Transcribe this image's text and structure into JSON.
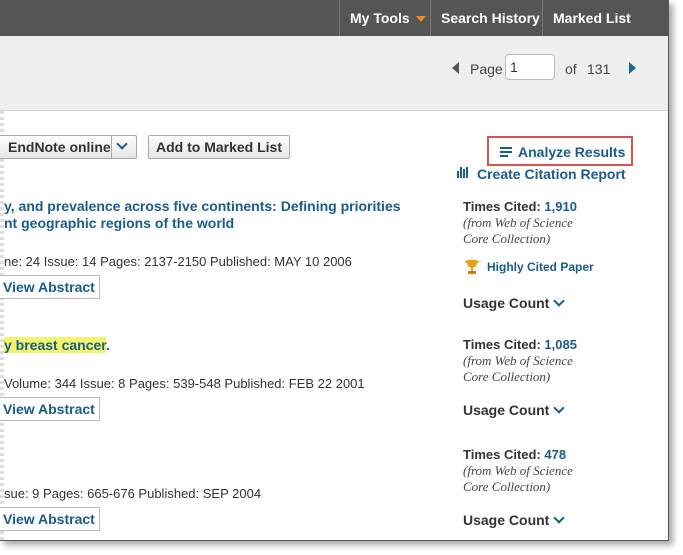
{
  "nav": {
    "my_tools": "My Tools",
    "search_history": "Search History",
    "marked_list": "Marked List"
  },
  "pager": {
    "page_label": "Page",
    "page_value": "1",
    "of_label": "of",
    "total_pages": "131"
  },
  "toolbar": {
    "endnote_label": "EndNote online",
    "add_marked": "Add to Marked List"
  },
  "side": {
    "analyze": "Analyze Results",
    "citation_report": "Create Citation Report"
  },
  "results": [
    {
      "title_line1": "y, and prevalence across five continents: Defining priorities",
      "title_line2": "nt geographic regions of the world",
      "meta": "ne: 24   Issue: 14   Pages: 2137-2150   Published: MAY 10 2006",
      "view_abstract": "View Abstract",
      "times_cited_label": "Times Cited:",
      "times_cited": "1,910",
      "source_line1": "(from Web of Science",
      "source_line2": "Core Collection)",
      "highly_cited": "Highly Cited Paper",
      "usage": "Usage Count"
    },
    {
      "title_highlight": "y breast cancer",
      "title_end": ".",
      "meta": "Volume: 344   Issue: 8   Pages: 539-548   Published: FEB 22 2001",
      "view_abstract": "View Abstract",
      "times_cited_label": "Times Cited:",
      "times_cited": "1,085",
      "source_line1": "(from Web of Science",
      "source_line2": "Core Collection)",
      "usage": "Usage Count"
    },
    {
      "meta": "sue: 9   Pages: 665-676   Published: SEP 2004",
      "view_abstract": "View Abstract",
      "times_cited_label": "Times Cited:",
      "times_cited": "478",
      "source_line1": "(from Web of Science",
      "source_line2": "Core Collection)",
      "usage": "Usage Count"
    }
  ],
  "colors": {
    "topbar": "#555555",
    "accent_orange": "#f08a24",
    "link_blue": "#1a5c8a",
    "highlight": "#f2f56b",
    "analyze_border": "#d9534f"
  },
  "icons": {
    "analyze": "list-lines-icon",
    "citation": "bar-chart-icon",
    "award": "trophy-icon"
  }
}
